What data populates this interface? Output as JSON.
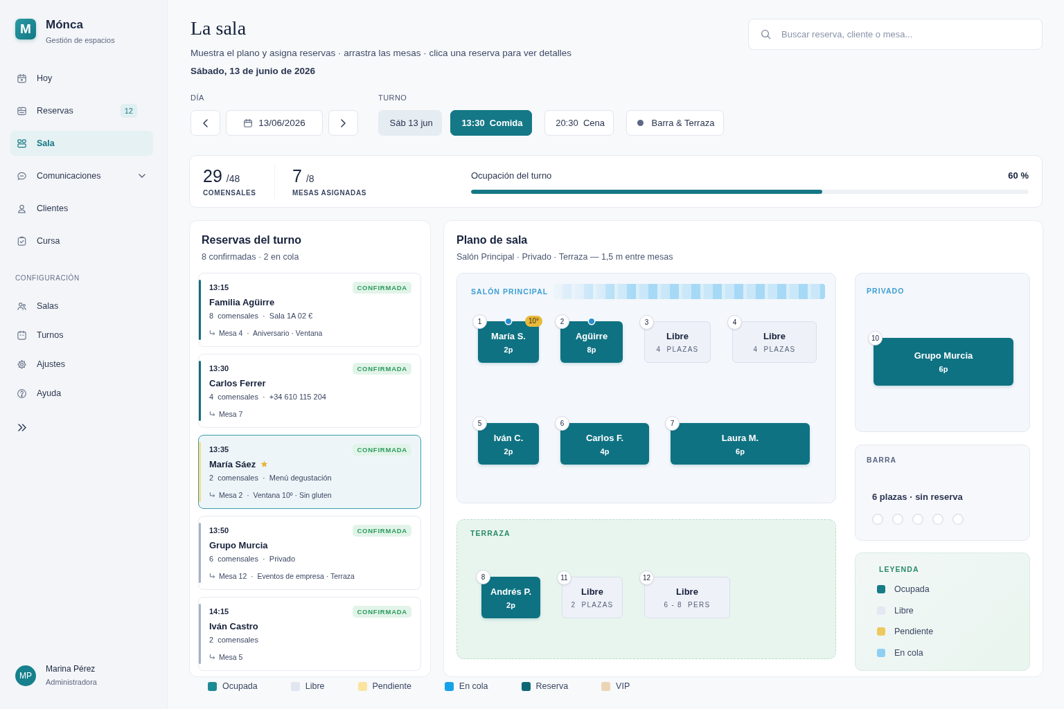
{
  "sidebar": {
    "brand": {
      "logo": "M",
      "name": "Mónca",
      "tagline": "Gestión de espacios"
    },
    "nav": [
      {
        "label": "Hoy",
        "selected": false
      },
      {
        "label": "Reservas",
        "selected": false,
        "badge": "12"
      },
      {
        "label": "Sala",
        "selected": true
      },
      {
        "label": "Comunicaciones",
        "selected": false,
        "expanded": false
      },
      {
        "label": "Clientes",
        "selected": false
      },
      {
        "label": "Cursa",
        "selected": false
      }
    ],
    "section_label": "CONFIGURACIÓN",
    "settings_nav": [
      {
        "label": "Salas",
        "selected": false
      },
      {
        "label": "Turnos",
        "selected": false
      },
      {
        "label": "Ajustes",
        "selected": false
      },
      {
        "label": "Ayuda",
        "selected": false
      }
    ],
    "user": {
      "initials": "MP",
      "name": "Marina Pérez",
      "role": "Administradora"
    }
  },
  "header": {
    "title": "La sala",
    "subtitle": "Muestra el plano y asigna reservas · arrastra las mesas · clica una reserva para ver detalles",
    "date": "Sábado, 13 de junio de 2026"
  },
  "search": {
    "placeholder": "Buscar reserva, cliente o mesa..."
  },
  "day_picker": {
    "label": "DÍA",
    "value": "13/06/2026"
  },
  "shift_picker": {
    "label": "TURNO",
    "chips": [
      {
        "label": "Sáb 13 jun",
        "kind": "day",
        "selected": false
      },
      {
        "label": "13:30  Comida",
        "kind": "shift",
        "selected": true
      },
      {
        "label": "20:30  Cena",
        "kind": "shift",
        "selected": false
      },
      {
        "label": "Barra & Terraza",
        "kind": "zone",
        "selected": false
      }
    ]
  },
  "stats": {
    "diners": {
      "value": "29",
      "total": "/48",
      "label": "COMENSALES"
    },
    "tables": {
      "value": "7",
      "total": "/8",
      "label": "MESAS ASIGNADAS"
    },
    "occupancy": {
      "label": "Ocupación del turno",
      "reading": "60 %",
      "level": 0.63
    }
  },
  "reservations": {
    "title": "Reservas del turno",
    "summary": "8 confirmadas · 2 en cola",
    "items": [
      {
        "time": "13:15",
        "status": "CONFIRMADA",
        "name": "Familia Agüirre",
        "vip": false,
        "details": "8  comensales  ·  Sala 1A 02 €",
        "table": "Mesa 4  ·  Aniversario · Ventana",
        "color": "#146d7d",
        "selected": false
      },
      {
        "time": "13:30",
        "status": "CONFIRMADA",
        "name": "Carlos Ferrer",
        "vip": false,
        "details": "4  comensales  ·  +34 610 115 204",
        "table": "Mesa 7",
        "color": "#146d7d",
        "selected": false
      },
      {
        "time": "13:35",
        "status": "CONFIRMADA",
        "name": "María Sáez",
        "vip": true,
        "details": "2  comensales  ·  Menú degustación",
        "table": "Mesa 2  ·  Ventana 10º · Sin gluten",
        "color": "#f6dc8c",
        "selected": true
      },
      {
        "time": "13:50",
        "status": "CONFIRMADA",
        "name": "Grupo Murcia",
        "vip": false,
        "details": "6  comensales  ·  Privado",
        "table": "Mesa 12  ·  Eventos de empresa · Terraza",
        "color": "#a6b3c9",
        "selected": false
      },
      {
        "time": "14:15",
        "status": "CONFIRMADA",
        "name": "Iván Castro",
        "vip": false,
        "details": "2  comensales",
        "table": "Mesa 5",
        "color": "#a6b3c9",
        "selected": false
      }
    ]
  },
  "floor_plan": {
    "title": "Plano de sala",
    "subtitle": "Salón Principal · Privado · Terraza — 1,5 m entre mesas",
    "main_room": {
      "label": "SALÓN PRINCIPAL",
      "rows": [
        [
          {
            "number": "1",
            "kind": "occupied",
            "name": "María S.",
            "seats": "2p",
            "queued": true,
            "badge": "10°"
          },
          {
            "number": "2",
            "kind": "occupied",
            "name": "Agüirre",
            "seats": "8p",
            "queued": true
          },
          {
            "number": "3",
            "kind": "free",
            "name": "Libre",
            "seats": "4  PLAZAS",
            "queued": false
          },
          {
            "number": "4",
            "kind": "free",
            "name": "Libre",
            "seats": "4  PLAZAS",
            "queued": false
          }
        ],
        [
          {
            "number": "5",
            "kind": "occupied",
            "name": "Iván C.",
            "seats": "2p",
            "queued": false
          },
          {
            "number": "6",
            "kind": "occupied",
            "name": "Carlos F.",
            "seats": "4p",
            "queued": false
          },
          {
            "number": "7",
            "kind": "occupied",
            "name": "Laura M.",
            "seats": "6p",
            "queued": false
          }
        ]
      ]
    },
    "private_room": {
      "label": "PRIVADO",
      "rows": [
        [
          {
            "number": "10",
            "kind": "occupied",
            "name": "Grupo Murcia",
            "seats": "6p",
            "queued": false
          }
        ]
      ]
    },
    "bar": {
      "label": "BARRA",
      "summary": "6 plazas · sin reserva"
    },
    "terrace": {
      "label": "TERRAZA",
      "rows": [
        [
          {
            "number": "8",
            "kind": "occupied",
            "name": "Andrés P.",
            "seats": "2p",
            "queued": false
          },
          {
            "number": "11",
            "kind": "free",
            "name": "Libre",
            "seats": "2  PLAZAS",
            "queued": false
          },
          {
            "number": "12",
            "kind": "free",
            "name": "Libre",
            "seats": "6 - 8  PERS",
            "queued": false
          }
        ]
      ]
    },
    "legend": {
      "title": "LEYENDA",
      "items": [
        {
          "label": "Ocupada",
          "color": "#177c88"
        },
        {
          "label": "Libre",
          "color": "#e4e8f2"
        },
        {
          "label": "Pendiente",
          "color": "#efc85e"
        },
        {
          "label": "En cola",
          "color": "#8ecff3"
        }
      ]
    }
  },
  "status_legend": [
    {
      "label": "Ocupada",
      "color": "#1d8a94"
    },
    {
      "label": "Libre",
      "color": "#e0e5ef"
    },
    {
      "label": "Pendiente",
      "color": "#fbe4a0"
    },
    {
      "label": "En cola",
      "color": "#16a2e6"
    },
    {
      "label": "Reserva",
      "color": "#0f6776"
    },
    {
      "label": "VIP",
      "color": "#ecd5b6"
    }
  ]
}
